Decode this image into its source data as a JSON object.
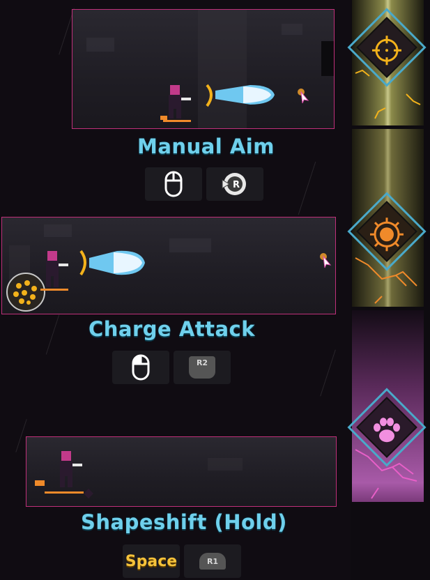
{
  "skills": [
    {
      "title": "Manual Aim",
      "keyboard_icon": "mouse-icon",
      "gamepad_label": "R",
      "gamepad_icon": "right-stick-icon"
    },
    {
      "title": "Charge Attack",
      "keyboard_icon": "mouse-left-button-icon",
      "gamepad_label": "R2",
      "gamepad_icon": "trigger-icon"
    },
    {
      "title": "Shapeshift (Hold)",
      "keyboard_label": "Space",
      "gamepad_label": "R1",
      "gamepad_icon": "bumper-icon"
    }
  ],
  "side_icons": [
    "crosshair-icon",
    "sun-burst-icon",
    "paw-icon"
  ],
  "colors": {
    "title": "#6fd0ec",
    "clip_border": "#c0307a",
    "aim_accent": "#f3b21b",
    "charge_accent": "#f08a2a",
    "shapeshift_accent": "#e85fc8",
    "space_key": "#f5c23a"
  }
}
